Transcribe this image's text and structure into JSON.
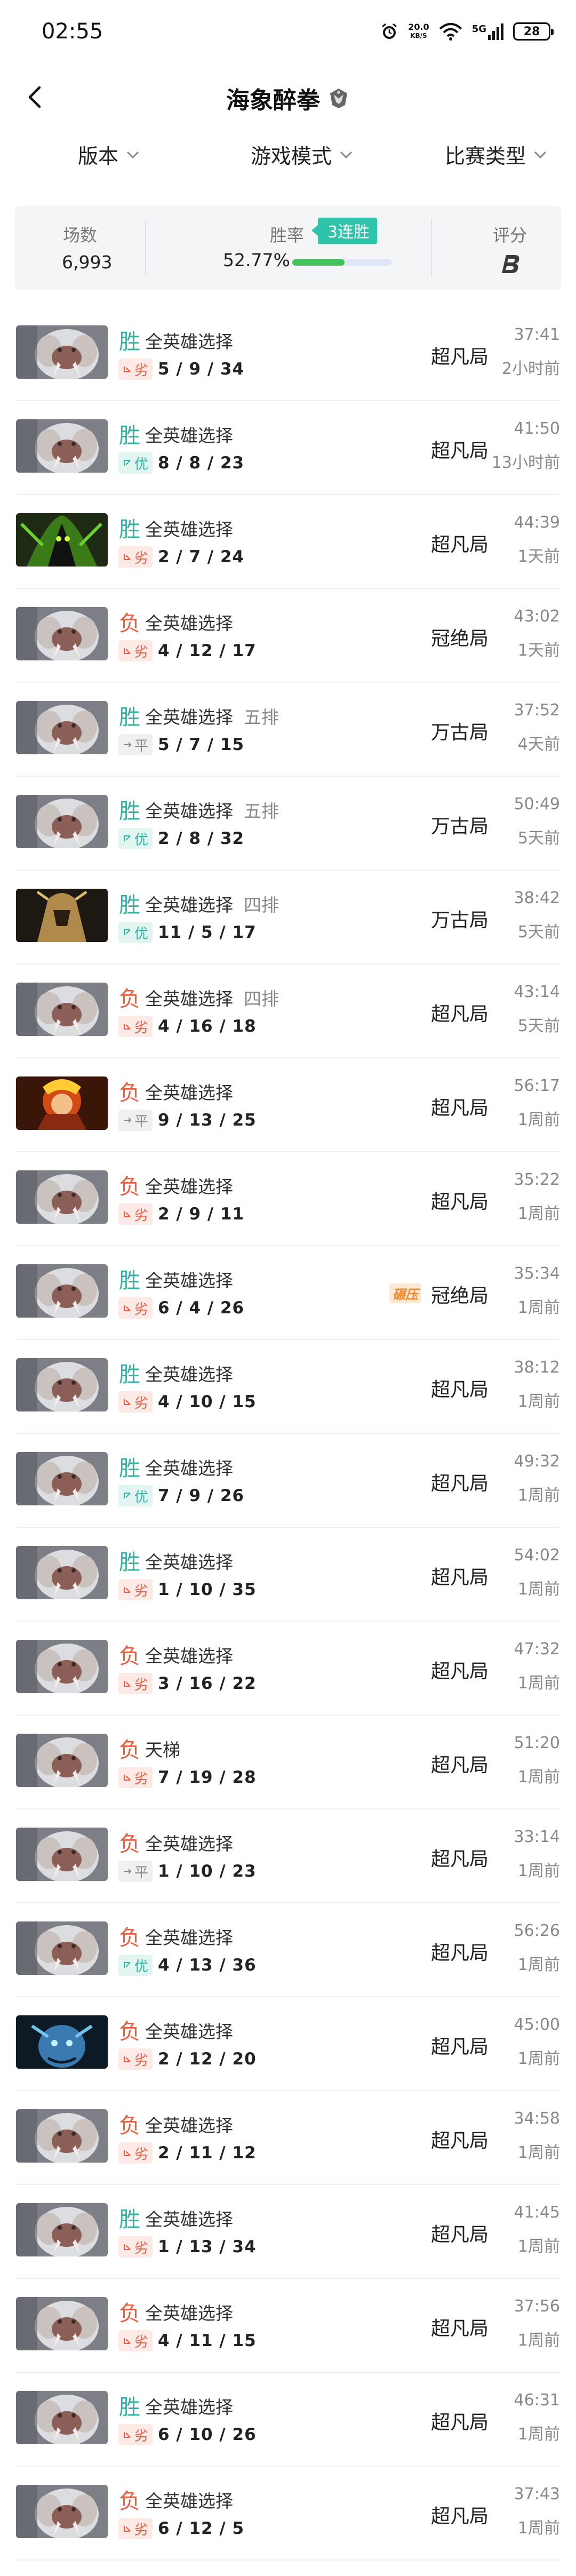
{
  "status": {
    "time": "02:55",
    "net_speed": "20.0",
    "net_unit": "KB/S",
    "signal": "5G",
    "battery": "28"
  },
  "header": {
    "title": "海象醉拳"
  },
  "filters": [
    "版本",
    "游戏模式",
    "比赛类型"
  ],
  "stats": {
    "matches_label": "场数",
    "matches_value": "6,993",
    "winrate_label": "胜率",
    "winrate_value": "52.77%",
    "winrate_fraction": 0.5277,
    "streak": "3连胜",
    "grade_label": "评分"
  },
  "colors": {
    "win": "#2ab6a0",
    "lose": "#ee5a3d",
    "progress": "#3fc35a",
    "streak": "#2fc4aa"
  },
  "matches": [
    {
      "result": "胜",
      "mode": "全英雄选择",
      "party": "",
      "perf": "劣",
      "kda": "5 / 9 / 34",
      "tier": "超凡局",
      "badge": "",
      "duration": "37:41",
      "ago": "2小时前",
      "hero": "tusk"
    },
    {
      "result": "胜",
      "mode": "全英雄选择",
      "party": "",
      "perf": "优",
      "kda": "8 / 8 / 23",
      "tier": "超凡局",
      "badge": "",
      "duration": "41:50",
      "ago": "13小时前",
      "hero": "tusk"
    },
    {
      "result": "胜",
      "mode": "全英雄选择",
      "party": "",
      "perf": "劣",
      "kda": "2 / 7 / 24",
      "tier": "超凡局",
      "badge": "",
      "duration": "44:39",
      "ago": "1天前",
      "hero": "green"
    },
    {
      "result": "负",
      "mode": "全英雄选择",
      "party": "",
      "perf": "劣",
      "kda": "4 / 12 / 17",
      "tier": "冠绝局",
      "badge": "",
      "duration": "43:02",
      "ago": "1天前",
      "hero": "tusk"
    },
    {
      "result": "胜",
      "mode": "全英雄选择",
      "party": "五排",
      "perf": "平",
      "kda": "5 / 7 / 15",
      "tier": "万古局",
      "badge": "",
      "duration": "37:52",
      "ago": "4天前",
      "hero": "tusk"
    },
    {
      "result": "胜",
      "mode": "全英雄选择",
      "party": "五排",
      "perf": "优",
      "kda": "2 / 8 / 32",
      "tier": "万古局",
      "badge": "",
      "duration": "50:49",
      "ago": "5天前",
      "hero": "tusk"
    },
    {
      "result": "胜",
      "mode": "全英雄选择",
      "party": "四排",
      "perf": "优",
      "kda": "11 / 5 / 17",
      "tier": "万古局",
      "badge": "",
      "duration": "38:42",
      "ago": "5天前",
      "hero": "armor"
    },
    {
      "result": "负",
      "mode": "全英雄选择",
      "party": "四排",
      "perf": "劣",
      "kda": "4 / 16 / 18",
      "tier": "超凡局",
      "badge": "",
      "duration": "43:14",
      "ago": "5天前",
      "hero": "tusk"
    },
    {
      "result": "负",
      "mode": "全英雄选择",
      "party": "",
      "perf": "平",
      "kda": "9 / 13 / 25",
      "tier": "超凡局",
      "badge": "",
      "duration": "56:17",
      "ago": "1周前",
      "hero": "fire"
    },
    {
      "result": "负",
      "mode": "全英雄选择",
      "party": "",
      "perf": "劣",
      "kda": "2 / 9 / 11",
      "tier": "超凡局",
      "badge": "",
      "duration": "35:22",
      "ago": "1周前",
      "hero": "tusk"
    },
    {
      "result": "胜",
      "mode": "全英雄选择",
      "party": "",
      "perf": "劣",
      "kda": "6 / 4 / 26",
      "tier": "冠绝局",
      "badge": "碾压",
      "duration": "35:34",
      "ago": "1周前",
      "hero": "tusk"
    },
    {
      "result": "胜",
      "mode": "全英雄选择",
      "party": "",
      "perf": "劣",
      "kda": "4 / 10 / 15",
      "tier": "超凡局",
      "badge": "",
      "duration": "38:12",
      "ago": "1周前",
      "hero": "tusk"
    },
    {
      "result": "胜",
      "mode": "全英雄选择",
      "party": "",
      "perf": "优",
      "kda": "7 / 9 / 26",
      "tier": "超凡局",
      "badge": "",
      "duration": "49:32",
      "ago": "1周前",
      "hero": "tusk"
    },
    {
      "result": "胜",
      "mode": "全英雄选择",
      "party": "",
      "perf": "劣",
      "kda": "1 / 10 / 35",
      "tier": "超凡局",
      "badge": "",
      "duration": "54:02",
      "ago": "1周前",
      "hero": "tusk"
    },
    {
      "result": "负",
      "mode": "全英雄选择",
      "party": "",
      "perf": "劣",
      "kda": "3 / 16 / 22",
      "tier": "超凡局",
      "badge": "",
      "duration": "47:32",
      "ago": "1周前",
      "hero": "tusk"
    },
    {
      "result": "负",
      "mode": "天梯",
      "party": "",
      "perf": "劣",
      "kda": "7 / 19 / 28",
      "tier": "超凡局",
      "badge": "",
      "duration": "51:20",
      "ago": "1周前",
      "hero": "tusk"
    },
    {
      "result": "负",
      "mode": "全英雄选择",
      "party": "",
      "perf": "平",
      "kda": "1 / 10 / 23",
      "tier": "超凡局",
      "badge": "",
      "duration": "33:14",
      "ago": "1周前",
      "hero": "tusk"
    },
    {
      "result": "负",
      "mode": "全英雄选择",
      "party": "",
      "perf": "优",
      "kda": "4 / 13 / 36",
      "tier": "超凡局",
      "badge": "",
      "duration": "56:26",
      "ago": "1周前",
      "hero": "tusk"
    },
    {
      "result": "负",
      "mode": "全英雄选择",
      "party": "",
      "perf": "劣",
      "kda": "2 / 12 / 20",
      "tier": "超凡局",
      "badge": "",
      "duration": "45:00",
      "ago": "1周前",
      "hero": "blue"
    },
    {
      "result": "负",
      "mode": "全英雄选择",
      "party": "",
      "perf": "劣",
      "kda": "2 / 11 / 12",
      "tier": "超凡局",
      "badge": "",
      "duration": "34:58",
      "ago": "1周前",
      "hero": "tusk"
    },
    {
      "result": "胜",
      "mode": "全英雄选择",
      "party": "",
      "perf": "劣",
      "kda": "1 / 13 / 34",
      "tier": "超凡局",
      "badge": "",
      "duration": "41:45",
      "ago": "1周前",
      "hero": "tusk"
    },
    {
      "result": "负",
      "mode": "全英雄选择",
      "party": "",
      "perf": "劣",
      "kda": "4 / 11 / 15",
      "tier": "超凡局",
      "badge": "",
      "duration": "37:56",
      "ago": "1周前",
      "hero": "tusk"
    },
    {
      "result": "胜",
      "mode": "全英雄选择",
      "party": "",
      "perf": "劣",
      "kda": "6 / 10 / 26",
      "tier": "超凡局",
      "badge": "",
      "duration": "46:31",
      "ago": "1周前",
      "hero": "tusk"
    },
    {
      "result": "负",
      "mode": "全英雄选择",
      "party": "",
      "perf": "劣",
      "kda": "6 / 12 / 5",
      "tier": "超凡局",
      "badge": "",
      "duration": "37:43",
      "ago": "1周前",
      "hero": "tusk"
    }
  ]
}
